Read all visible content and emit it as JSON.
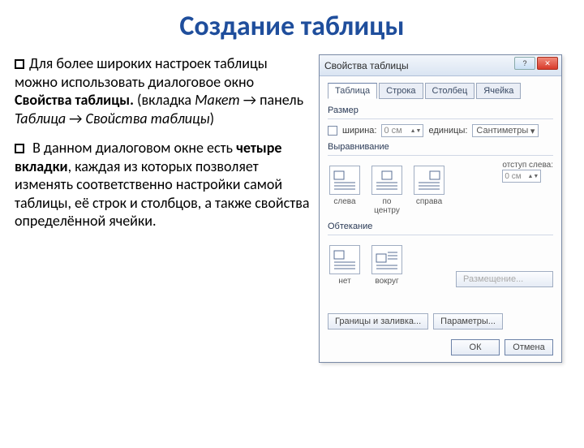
{
  "page": {
    "title": "Создание таблицы"
  },
  "para1": {
    "t1": "Для более широких настроек таблицы можно использовать диалоговое окно ",
    "bold": "Свойства таблицы.",
    "t2": " (вкладка ",
    "i1": "Макет",
    "arrow1": " → панель ",
    "i2": "Таблица",
    "arrow2": " → ",
    "i3": "Свойства таблицы",
    "t3": ")"
  },
  "para2": {
    "t1": " В данном диалоговом окне есть ",
    "bold": "четыре вкладки",
    "t2": ", каждая из которых позволяет изменять соответственно настройки самой таблицы, её строк и столбцов, а также свойства определённой ячейки."
  },
  "dialog": {
    "title": "Свойства таблицы",
    "tabs": [
      "Таблица",
      "Строка",
      "Столбец",
      "Ячейка"
    ],
    "size_label": "Размер",
    "width_label": "ширина:",
    "width_val": "0 см",
    "units_label": "единицы:",
    "units_val": "Сантиметры",
    "align_label": "Выравнивание",
    "align_opts": [
      "слева",
      "по центру",
      "справа"
    ],
    "indent_label": "отступ слева:",
    "indent_val": "0 см",
    "wrap_label": "Обтекание",
    "wrap_opts": [
      "нет",
      "вокруг"
    ],
    "btn_position": "Размещение...",
    "btn_borders": "Границы и заливка...",
    "btn_params": "Параметры...",
    "btn_ok": "ОК",
    "btn_cancel": "Отмена"
  }
}
